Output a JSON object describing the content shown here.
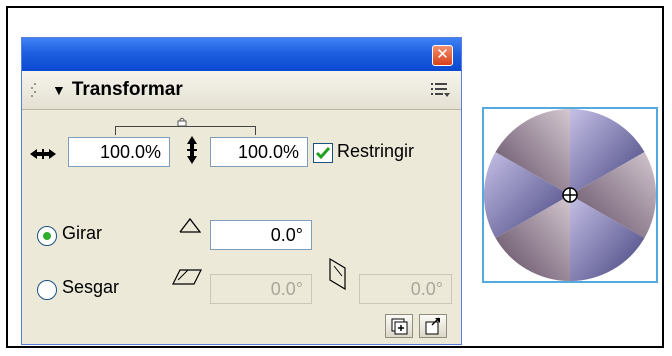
{
  "panel": {
    "close_glyph": "✕",
    "title_arrow": "▼",
    "title": "Transformar",
    "menu_icon": "panel-options-icon"
  },
  "scale": {
    "width_value": "100.0%",
    "height_value": "100.0%",
    "constrain_checked": true,
    "constrain_label": "Restringir"
  },
  "rotate": {
    "selected": true,
    "label": "Girar",
    "value": "0.0°"
  },
  "skew": {
    "selected": false,
    "label": "Sesgar",
    "horizontal_value": "0.0°",
    "vertical_value": "0.0°"
  },
  "buttons": {
    "copy_transform": "copy-and-apply-transform-icon",
    "reset": "reset-transform-icon"
  },
  "colors": {
    "title_bar": "#1d5fe0",
    "panel_bg": "#ece9d8",
    "close_button": "#d8401a",
    "radio_selected": "#2fae2f",
    "check": "#1fa020",
    "preview_border": "#55aadd"
  }
}
